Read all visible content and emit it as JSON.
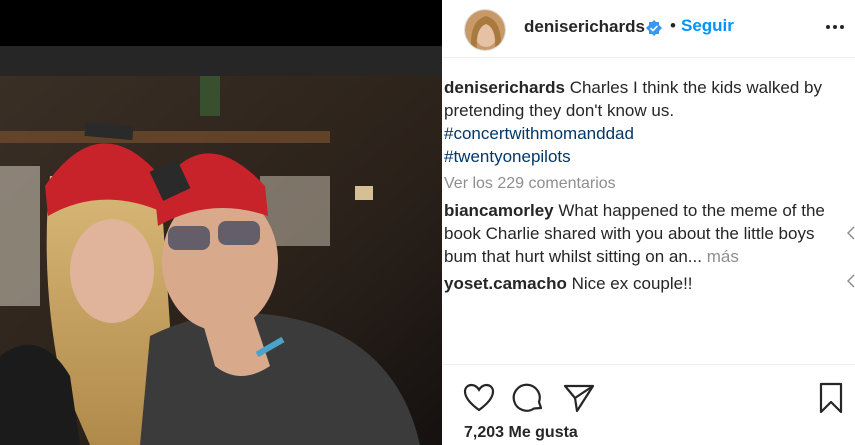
{
  "post": {
    "username": "deniserichards",
    "follow_label": "Seguir",
    "header_separator": "•",
    "caption": "Charles I think the kids walked by pretending they don't know us.",
    "hashtags": [
      "#concertwithmomanddad",
      "#twentyonepilots"
    ],
    "view_comments": "Ver los 229 comentarios",
    "likes": "7,203 Me gusta"
  },
  "comments": [
    {
      "user": "biancamorley",
      "text": "What happened to the meme of the book Charlie shared with you about the little boys bum that hurt whilst sitting on an...",
      "more": "más"
    },
    {
      "user": "yoset.camacho",
      "text": "Nice ex couple!!",
      "more": ""
    }
  ],
  "icons": {
    "verified": "verified-badge-icon",
    "more": "more-options-icon",
    "like": "heart-icon",
    "comment": "comment-bubble-icon",
    "share": "paper-plane-icon",
    "save": "bookmark-icon",
    "reply": "reply-chevron-icon"
  },
  "colors": {
    "link": "#0095f6",
    "hashtag": "#00376b",
    "muted": "#8e8e8e",
    "text": "#262626"
  }
}
